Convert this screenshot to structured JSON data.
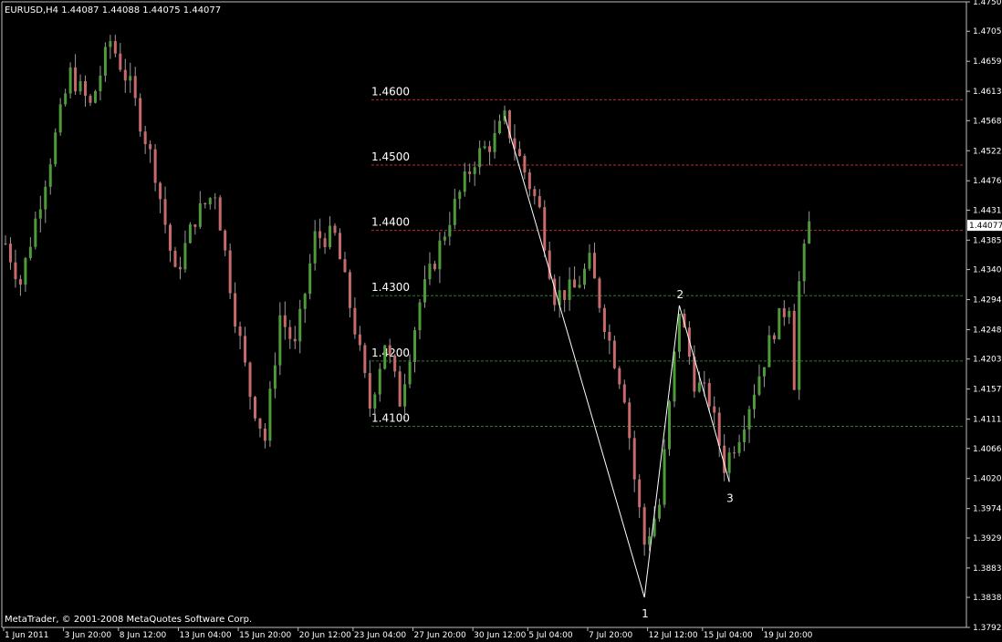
{
  "header": {
    "symbol_text": "EURUSD,H4  1.44087 1.44088 1.44075 1.44077"
  },
  "footer": {
    "copyright": "MetaTrader, © 2001-2008 MetaQuotes Software Corp."
  },
  "colors": {
    "background": "#000000",
    "axis": "#c0c0c0",
    "bull_candle": "#4f9a3a",
    "bear_candle": "#c86a6a",
    "wick": "#9a9a9a",
    "resistance_line": "#b03030",
    "support_line": "#2f7a2f",
    "wave_line": "#ffffff",
    "bid_marker": "#ffffff"
  },
  "chart_data": {
    "type": "candlestick",
    "symbol": "EURUSD",
    "timeframe": "H4",
    "last_quote": {
      "open": 1.44087,
      "high": 1.44088,
      "low": 1.44075,
      "close": 1.44077
    },
    "current_price_label": "1.44077",
    "y_range": [
      1.3792,
      1.475
    ],
    "y_ticks": [
      "1.47500",
      "1.47050",
      "1.46590",
      "1.46130",
      "1.45680",
      "1.45220",
      "1.44760",
      "1.44310",
      "1.43850",
      "1.43400",
      "1.42940",
      "1.42480",
      "1.42030",
      "1.41570",
      "1.41110",
      "1.40660",
      "1.40200",
      "1.39740",
      "1.39290",
      "1.38830",
      "1.38380",
      "1.37920"
    ],
    "x_ticks": [
      "1 Jun 2011",
      "3 Jun 20:00",
      "8 Jun 12:00",
      "13 Jun 04:00",
      "15 Jun 20:00",
      "20 Jun 12:00",
      "23 Jun 04:00",
      "27 Jun 20:00",
      "30 Jun 12:00",
      "5 Jul 04:00",
      "7 Jul 20:00",
      "12 Jul 12:00",
      "15 Jul 04:00",
      "19 Jul 20:00"
    ],
    "bar_count": 162,
    "price_path": [
      {
        "bar": 0,
        "close": 1.438
      },
      {
        "bar": 3,
        "close": 1.432
      },
      {
        "bar": 8,
        "close": 1.448
      },
      {
        "bar": 13,
        "close": 1.464
      },
      {
        "bar": 17,
        "close": 1.459
      },
      {
        "bar": 21,
        "close": 1.469
      },
      {
        "bar": 25,
        "close": 1.462
      },
      {
        "bar": 30,
        "close": 1.449
      },
      {
        "bar": 34,
        "close": 1.433
      },
      {
        "bar": 38,
        "close": 1.442
      },
      {
        "bar": 42,
        "close": 1.446
      },
      {
        "bar": 46,
        "close": 1.427
      },
      {
        "bar": 49,
        "close": 1.415
      },
      {
        "bar": 52,
        "close": 1.408
      },
      {
        "bar": 55,
        "close": 1.427
      },
      {
        "bar": 58,
        "close": 1.422
      },
      {
        "bar": 62,
        "close": 1.439
      },
      {
        "bar": 66,
        "close": 1.439
      },
      {
        "bar": 70,
        "close": 1.425
      },
      {
        "bar": 73,
        "close": 1.413
      },
      {
        "bar": 76,
        "close": 1.423
      },
      {
        "bar": 79,
        "close": 1.414
      },
      {
        "bar": 83,
        "close": 1.429
      },
      {
        "bar": 89,
        "close": 1.442
      },
      {
        "bar": 94,
        "close": 1.451
      },
      {
        "bar": 98,
        "close": 1.454
      },
      {
        "bar": 100,
        "close": 1.457
      },
      {
        "bar": 103,
        "close": 1.451
      },
      {
        "bar": 107,
        "close": 1.443
      },
      {
        "bar": 110,
        "close": 1.43
      },
      {
        "bar": 114,
        "close": 1.431
      },
      {
        "bar": 117,
        "close": 1.435
      },
      {
        "bar": 121,
        "close": 1.423
      },
      {
        "bar": 124,
        "close": 1.415
      },
      {
        "bar": 126,
        "close": 1.402
      },
      {
        "bar": 128,
        "close": 1.392
      },
      {
        "bar": 131,
        "close": 1.398
      },
      {
        "bar": 135,
        "close": 1.428
      },
      {
        "bar": 138,
        "close": 1.417
      },
      {
        "bar": 141,
        "close": 1.414
      },
      {
        "bar": 144,
        "close": 1.404
      },
      {
        "bar": 147,
        "close": 1.409
      },
      {
        "bar": 151,
        "close": 1.418
      },
      {
        "bar": 154,
        "close": 1.425
      },
      {
        "bar": 157,
        "close": 1.429
      },
      {
        "bar": 158,
        "close": 1.417
      },
      {
        "bar": 159,
        "close": 1.432
      },
      {
        "bar": 161,
        "close": 1.4408
      }
    ],
    "levels": [
      {
        "value": 1.46,
        "label": "1.4600",
        "kind": "resistance"
      },
      {
        "value": 1.45,
        "label": "1.4500",
        "kind": "resistance"
      },
      {
        "value": 1.44,
        "label": "1.4400",
        "kind": "resistance"
      },
      {
        "value": 1.43,
        "label": "1.4300",
        "kind": "support"
      },
      {
        "value": 1.42,
        "label": "1.4200",
        "kind": "support"
      },
      {
        "value": 1.41,
        "label": "1.4100",
        "kind": "support"
      }
    ],
    "wave_points": [
      {
        "label": "",
        "bar": 100,
        "price": 1.4575
      },
      {
        "label": "1",
        "bar": 128,
        "price": 1.3838
      },
      {
        "label": "2",
        "bar": 135,
        "price": 1.4285
      },
      {
        "label": "3",
        "bar": 145,
        "price": 1.4015
      }
    ],
    "annotations": [
      "1",
      "2",
      "3"
    ]
  }
}
